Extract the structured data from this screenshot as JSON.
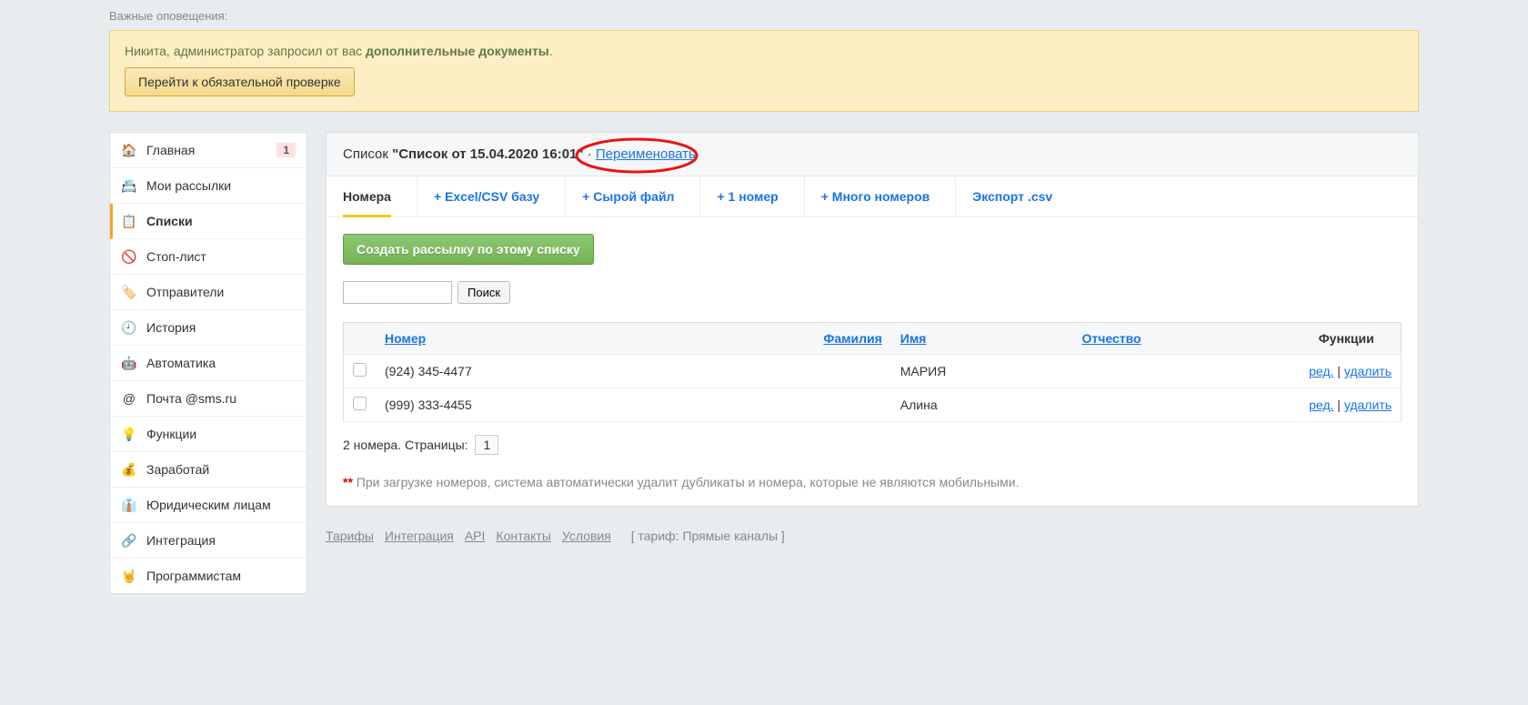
{
  "alerts_header": "Важные оповещения:",
  "alert": {
    "text_before": "Никита, администратор запросил от вас ",
    "text_bold": "дополнительные документы",
    "text_after": ".",
    "button": "Перейти к обязательной проверке"
  },
  "sidebar": [
    {
      "icon": "🏠",
      "label": "Главная",
      "badge": "1"
    },
    {
      "icon": "📇",
      "label": "Мои рассылки"
    },
    {
      "icon": "📋",
      "label": "Списки",
      "active": true
    },
    {
      "icon": "🚫",
      "label": "Стоп-лист"
    },
    {
      "icon": "🏷️",
      "label": "Отправители"
    },
    {
      "icon": "🕘",
      "label": "История"
    },
    {
      "icon": "🤖",
      "label": "Автоматика"
    },
    {
      "icon": "@",
      "label": "Почта @sms.ru"
    },
    {
      "icon": "💡",
      "label": "Функции"
    },
    {
      "icon": "💰",
      "label": "Заработай"
    },
    {
      "icon": "👔",
      "label": "Юридическим лицам"
    },
    {
      "icon": "🔗",
      "label": "Интеграция"
    },
    {
      "icon": "🤘",
      "label": "Программистам"
    }
  ],
  "panel": {
    "title_prefix": "Список ",
    "title_quoted": "\"Список от 15.04.2020 16:01\"",
    "sep": " · ",
    "rename": "Переименовать"
  },
  "tabs": [
    {
      "label": "Номера",
      "active": true
    },
    {
      "label": "+ Excel/CSV базу"
    },
    {
      "label": "+ Сырой файл"
    },
    {
      "label": "+ 1 номер"
    },
    {
      "label": "+ Много номеров"
    },
    {
      "label": "Экспорт .csv"
    }
  ],
  "create_button": "Создать рассылку по этому списку",
  "search": {
    "value": "",
    "button": "Поиск"
  },
  "table": {
    "headers": {
      "number": "Номер",
      "surname": "Фамилия",
      "name": "Имя",
      "patronymic": "Отчество",
      "functions": "Функции"
    },
    "rows": [
      {
        "number": "(924) 345-4477",
        "surname": "",
        "name": "МАРИЯ",
        "patronymic": "",
        "edit": "ред.",
        "sep": " | ",
        "del": "удалить"
      },
      {
        "number": "(999) 333-4455",
        "surname": "",
        "name": "Алина",
        "patronymic": "",
        "edit": "ред.",
        "sep": " | ",
        "del": "удалить"
      }
    ]
  },
  "pager": {
    "text": "2 номера. Страницы:",
    "page": "1"
  },
  "footnote": {
    "marker": "**",
    "text": " При загрузке номеров, система автоматически удалит дубликаты и номера, которые не являются мобильными."
  },
  "footer": {
    "links": [
      "Тарифы",
      "Интеграция",
      "API",
      "Контакты",
      "Условия"
    ],
    "tariff": "[ тариф: Прямые каналы ]"
  }
}
